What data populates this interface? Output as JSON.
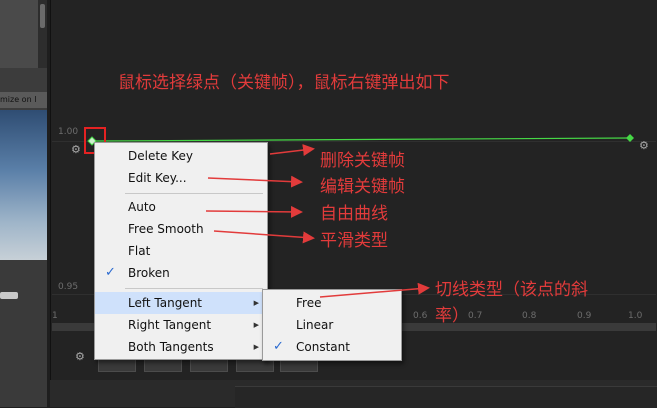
{
  "annotations": {
    "title": "鼠标选择绿点（关键帧），鼠标右键弹出如下",
    "delete": "删除关键帧",
    "edit": "编辑关键帧",
    "auto": "自由曲线",
    "free_smooth": "平滑类型",
    "tangent_line1": "切线类型（该点的斜",
    "tangent_line2": "率）"
  },
  "left_panel": {
    "tab_label": "mize on l"
  },
  "curve": {
    "y_labels": [
      "1.00",
      "0.95"
    ],
    "x_labels": [
      "1",
      "0.6",
      "0.7",
      "0.8",
      "0.9",
      "1.0"
    ],
    "curve_color": "#46d846"
  },
  "context_menu": {
    "items": [
      {
        "label": "Delete Key",
        "checked": false
      },
      {
        "label": "Edit Key...",
        "checked": false
      },
      {
        "label": "Auto",
        "checked": false
      },
      {
        "label": "Free Smooth",
        "checked": false
      },
      {
        "label": "Flat",
        "checked": false
      },
      {
        "label": "Broken",
        "checked": true
      },
      {
        "label": "Left Tangent",
        "submenu": true
      },
      {
        "label": "Right Tangent",
        "submenu": true
      },
      {
        "label": "Both Tangents",
        "submenu": true
      }
    ],
    "checkmark": "✓"
  },
  "submenu": {
    "items": [
      {
        "label": "Free",
        "checked": false
      },
      {
        "label": "Linear",
        "checked": false
      },
      {
        "label": "Constant",
        "checked": true
      }
    ]
  },
  "colors": {
    "annotation": "#e23b3b",
    "highlight": "#cfe1fb",
    "selection_box": "#e52222"
  }
}
